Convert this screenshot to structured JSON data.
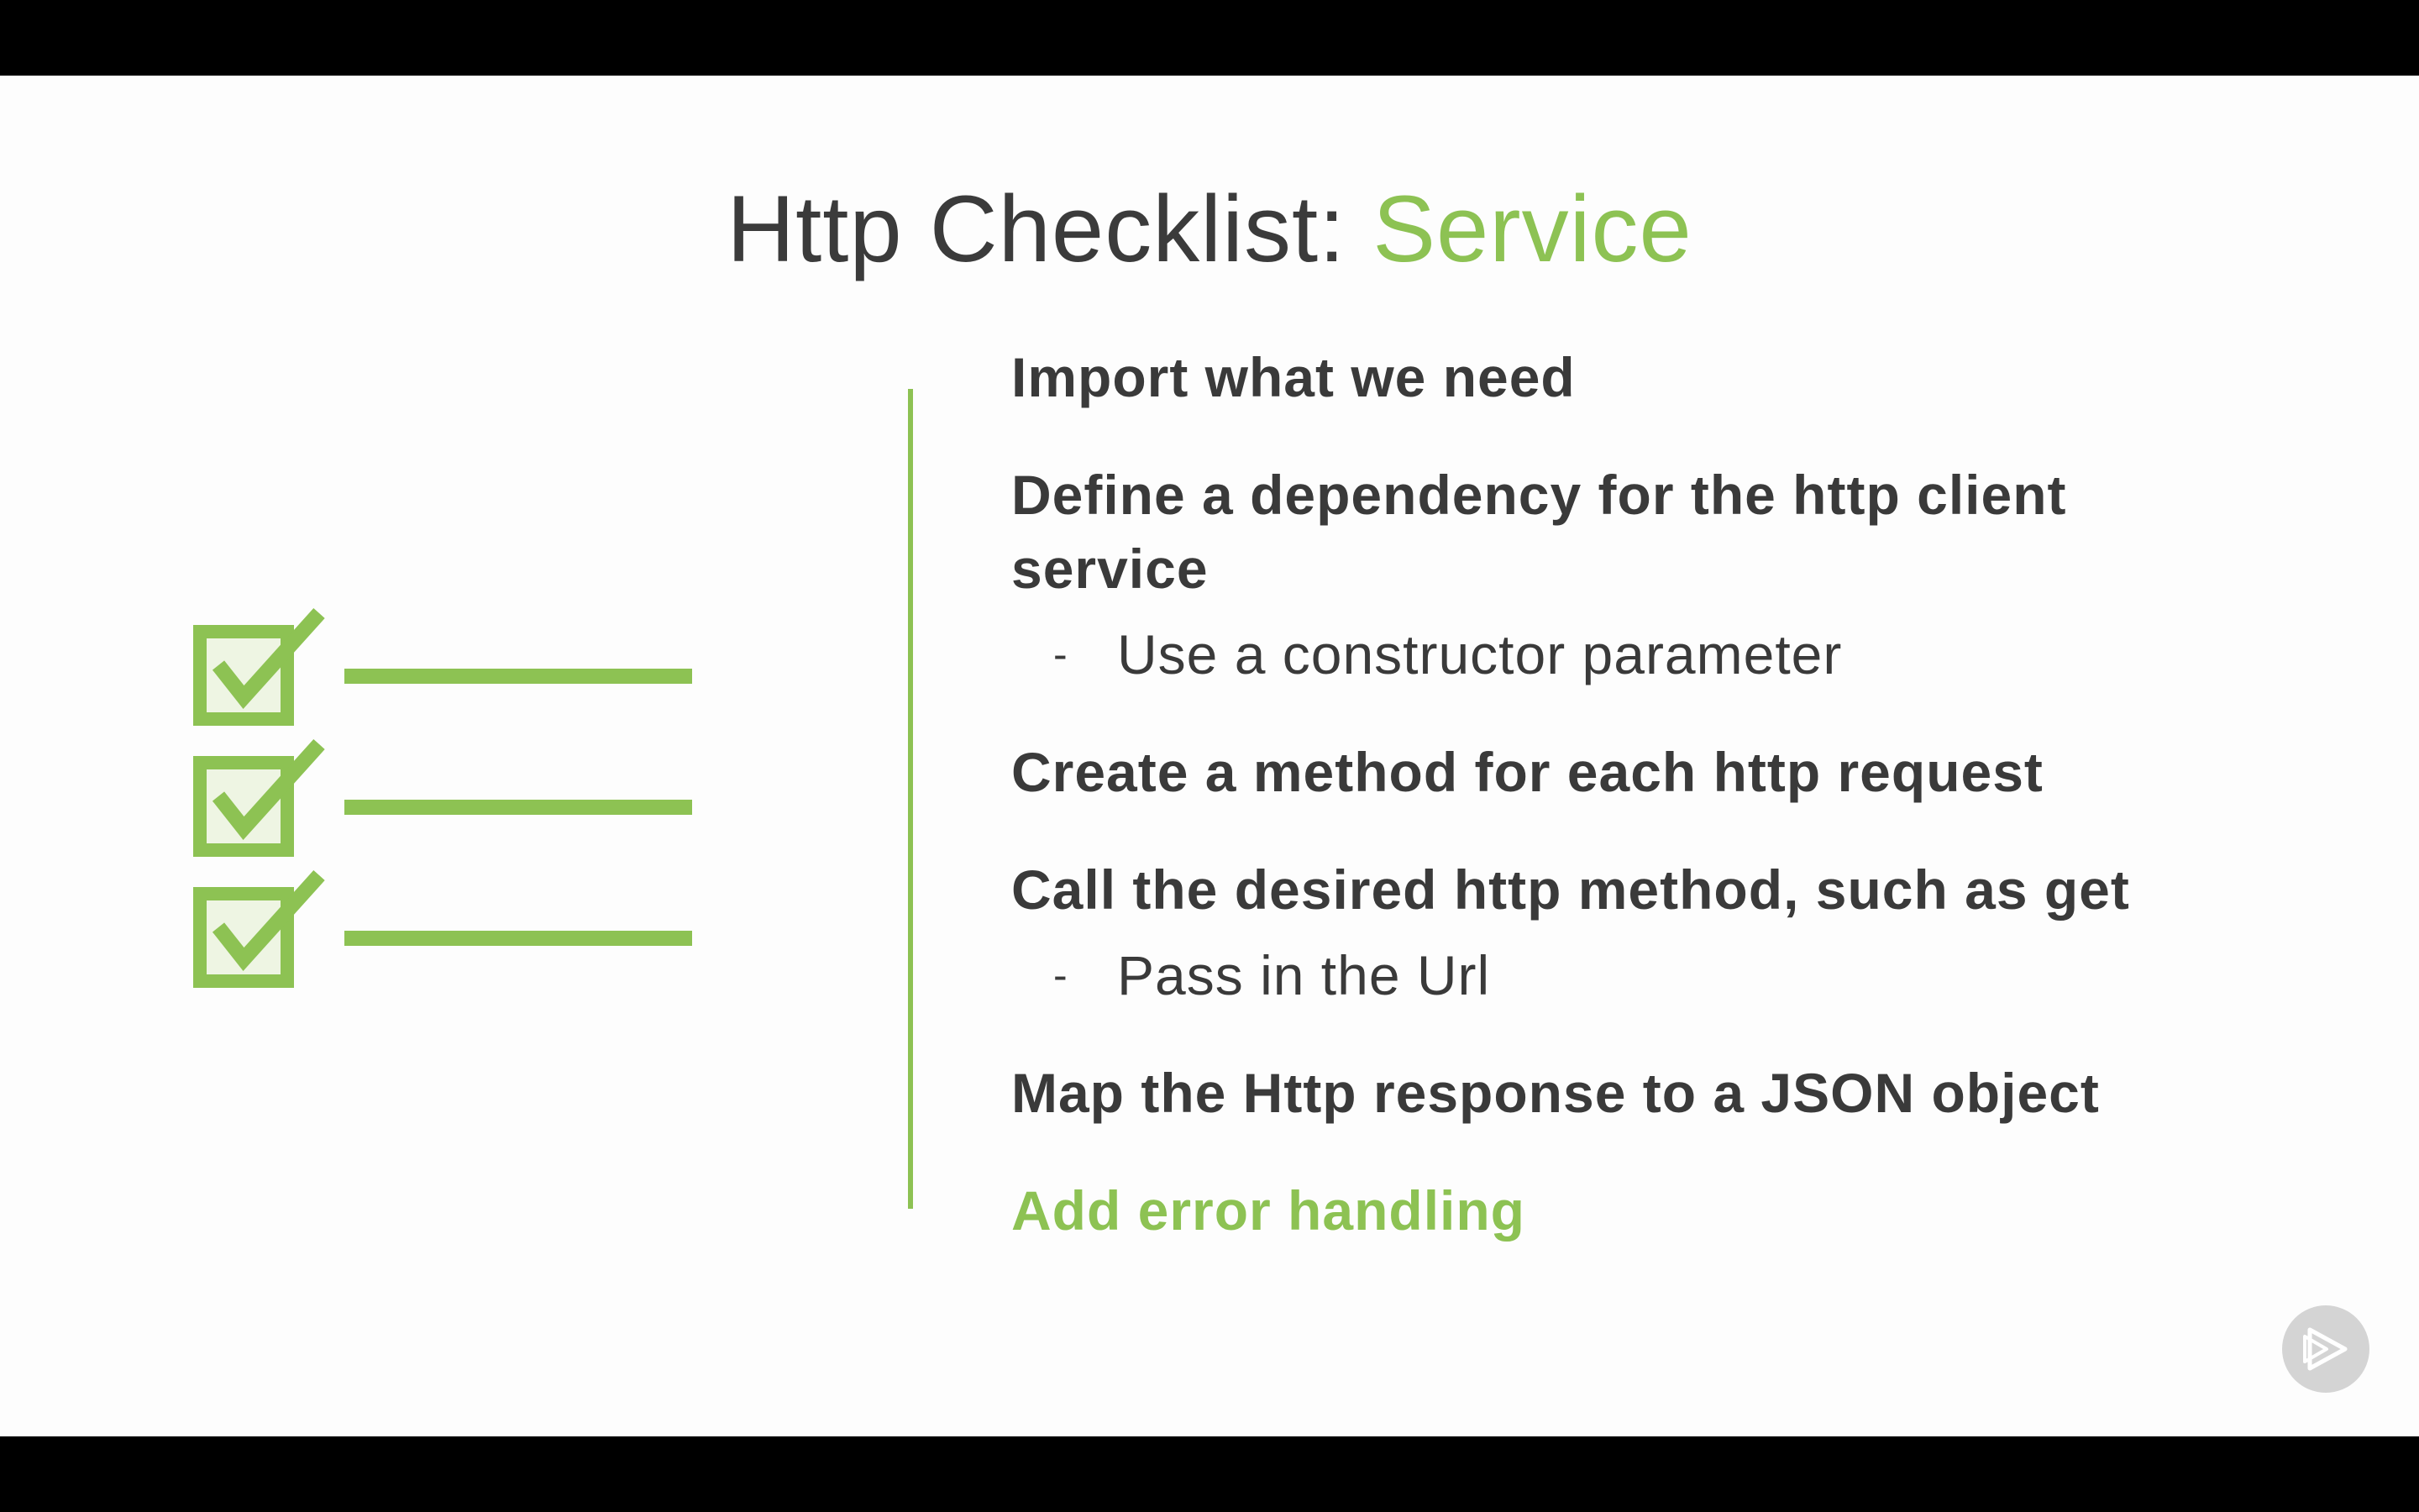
{
  "colors": {
    "accent": "#8dc253",
    "text": "#3a3a3a",
    "icon_fill": "#eef5e3"
  },
  "slide": {
    "title_main": "Http Checklist: ",
    "title_accent": "Service",
    "items": [
      {
        "label": "Import what we need"
      },
      {
        "label": "Define a dependency for the http client service",
        "line1": "Define a dependency for the http client",
        "line2": "service",
        "subitems": [
          "Use a constructor parameter"
        ]
      },
      {
        "label": "Create a method for each http request"
      },
      {
        "label": "Call the desired http method, such as get",
        "subitems": [
          "Pass in the Url"
        ]
      },
      {
        "label": "Map the Http response to a JSON object"
      },
      {
        "label": "Add error handling",
        "highlighted": true
      }
    ],
    "bullet_char": "-"
  },
  "icons": {
    "checklist": "checklist-icon",
    "player": "pluralsight-play-icon"
  }
}
